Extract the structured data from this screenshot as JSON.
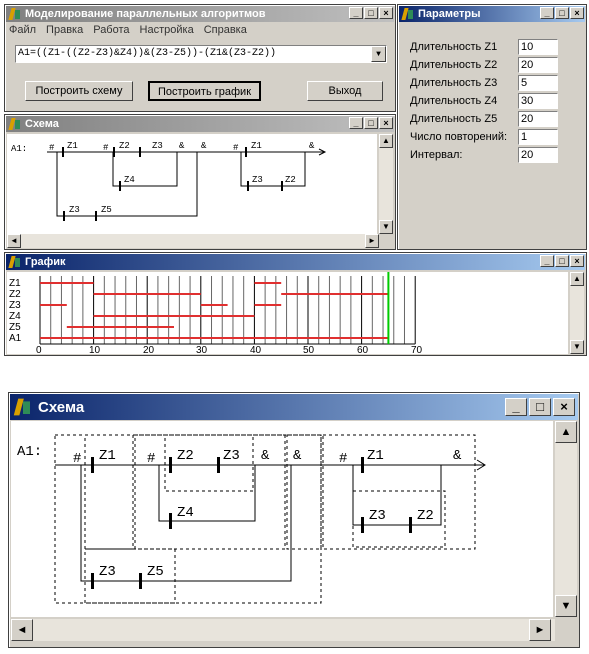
{
  "main_window": {
    "title": "Моделирование параллельных алгоритмов",
    "menu": [
      "Файл",
      "Правка",
      "Работа",
      "Настройка",
      "Справка"
    ],
    "expression": "A1=((Z1-((Z2-Z3)&Z4))&(Z3-Z5))-(Z1&(Z3-Z2))",
    "btn_build_scheme": "Построить схему",
    "btn_build_graph": "Построить график",
    "btn_exit": "Выход"
  },
  "params_window": {
    "title": "Параметры",
    "rows": [
      {
        "label": "Длительность Z1",
        "value": "10"
      },
      {
        "label": "Длительность Z2",
        "value": "20"
      },
      {
        "label": "Длительность Z3",
        "value": "5"
      },
      {
        "label": "Длительность Z4",
        "value": "30"
      },
      {
        "label": "Длительность Z5",
        "value": "20"
      },
      {
        "label": "Число повторений:",
        "value": "1"
      },
      {
        "label": "Интервал:",
        "value": "20"
      }
    ]
  },
  "scheme_small": {
    "title": "Схема",
    "row_label": "A1:",
    "tokens": [
      "#",
      "Z1",
      "#",
      "Z2",
      "Z3",
      "&",
      "&",
      "#",
      "Z1",
      "&",
      "Z4",
      "Z3",
      "Z2",
      "Z3",
      "Z5"
    ]
  },
  "graph_window": {
    "title": "График",
    "rows": [
      "Z1",
      "Z2",
      "Z3",
      "Z4",
      "Z5",
      "A1"
    ],
    "x_ticks": [
      "0",
      "10",
      "20",
      "30",
      "40",
      "50",
      "60",
      "70"
    ]
  },
  "chart_data": {
    "type": "gantt",
    "x_range": [
      0,
      70
    ],
    "marker_x": 65,
    "grid_step": 2,
    "series": [
      {
        "name": "Z1",
        "intervals": [
          [
            0,
            10
          ],
          [
            40,
            45
          ]
        ]
      },
      {
        "name": "Z2",
        "intervals": [
          [
            10,
            30
          ],
          [
            45,
            65
          ]
        ]
      },
      {
        "name": "Z3",
        "intervals": [
          [
            0,
            5
          ],
          [
            30,
            35
          ],
          [
            40,
            45
          ]
        ]
      },
      {
        "name": "Z4",
        "intervals": [
          [
            10,
            40
          ]
        ]
      },
      {
        "name": "Z5",
        "intervals": [
          [
            5,
            25
          ]
        ]
      },
      {
        "name": "A1",
        "intervals": [
          [
            0,
            65
          ]
        ]
      }
    ],
    "color": "#e03030",
    "marker_color": "#00cc00"
  },
  "scheme_large": {
    "title": "Схема",
    "row_label": "A1:",
    "tokens": [
      "#",
      "Z1",
      "#",
      "Z2",
      "Z3",
      "&",
      "&",
      "#",
      "Z1",
      "&",
      "Z4",
      "Z3",
      "Z2",
      "Z3",
      "Z5"
    ]
  }
}
